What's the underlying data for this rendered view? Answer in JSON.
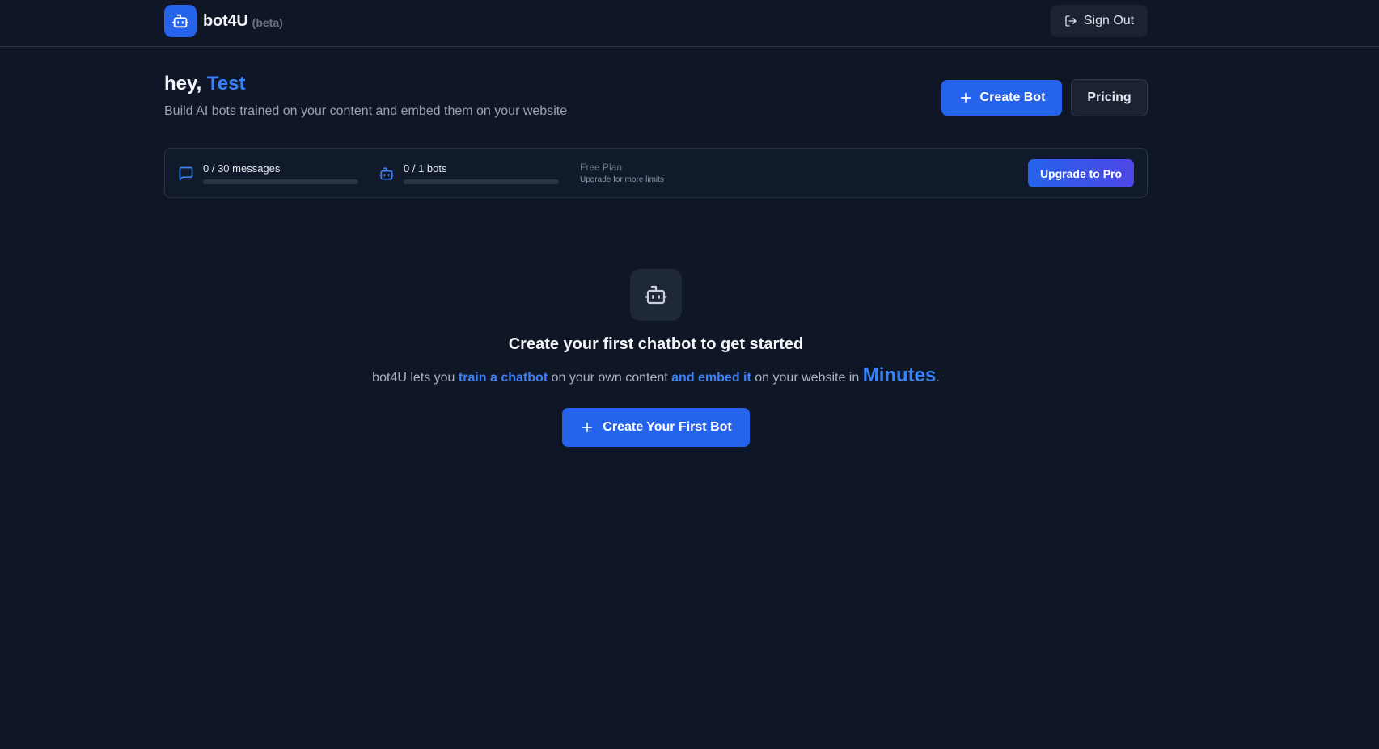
{
  "brand": {
    "name": "bot4U",
    "tag": "(beta)",
    "logo_icon": "robot-icon"
  },
  "topbar": {
    "signout_label": "Sign Out",
    "signout_icon": "sign-out-icon"
  },
  "header": {
    "greeting": "hey,",
    "username": "Test",
    "subtitle": "Build AI bots trained on your content and embed them on your website",
    "create_bot_label": "Create Bot",
    "pricing_label": "Pricing"
  },
  "usage": {
    "messages": {
      "label": "0 / 30 messages",
      "used": 0,
      "limit": 30,
      "icon": "message-icon"
    },
    "bots": {
      "label": "0 / 1 bots",
      "used": 0,
      "limit": 1,
      "icon": "robot-icon"
    },
    "plan_name": "Free Plan",
    "plan_hint": "Upgrade for more limits",
    "upgrade_label": "Upgrade to Pro"
  },
  "empty_state": {
    "icon": "robot-icon",
    "title": "Create your first chatbot to get started",
    "desc_part1": "bot4U lets you",
    "desc_hl1": "train a chatbot",
    "desc_part2": "on your own content",
    "desc_hl2": "and embed it",
    "desc_part3": "on your website in",
    "desc_hl3": "Minutes",
    "desc_end": ".",
    "cta_label": "Create Your First Bot"
  },
  "colors": {
    "background": "#0f1626",
    "accent": "#2563eb",
    "accent_text": "#3b82f6",
    "upgrade_gradient_end": "#4f46e5"
  }
}
